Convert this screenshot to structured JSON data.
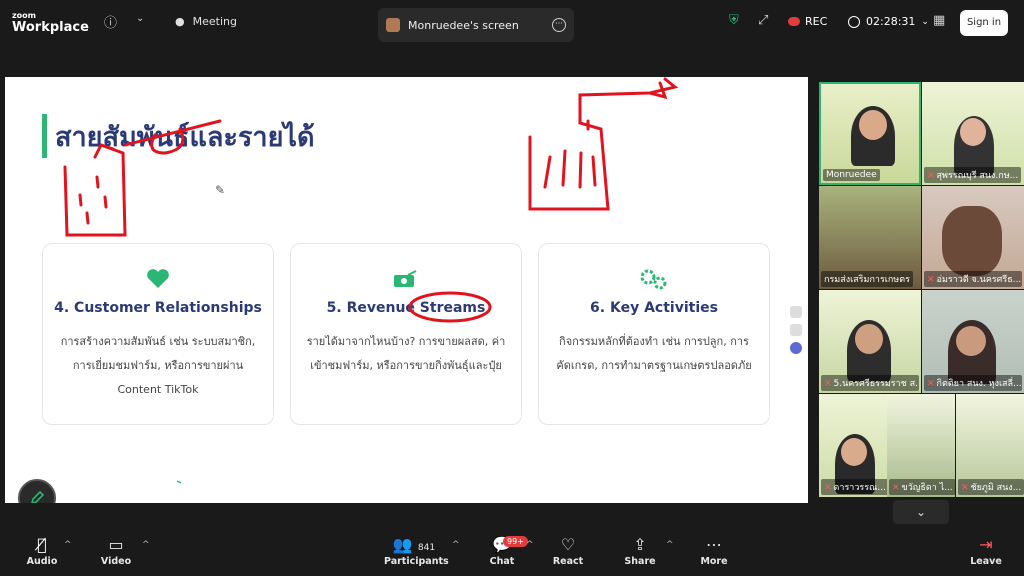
{
  "app": {
    "logo_small": "zoom",
    "logo_big": "Workplace"
  },
  "topbar": {
    "meeting_label": "Meeting",
    "screen_tab_label": "Monruedee's screen",
    "rec_label": "REC",
    "timer": "02:28:31",
    "signin_label": "Sign in"
  },
  "slide": {
    "title": "สายสัมพันธ์และรายได้",
    "cards": [
      {
        "heading": "4. Customer Relationships",
        "body": "การสร้างความสัมพันธ์ เช่น ระบบสมาชิก, การเยี่ยมชมฟาร์ม, หรือการขายผ่าน Content TikTok",
        "icon": "heart-icon"
      },
      {
        "heading": "5. Revenue Streams",
        "body": "รายได้มาจากไหนบ้าง? การขายผลสด, ค่าเข้าชมฟาร์ม, หรือการขายกิ่งพันธุ์และปุ๋ย",
        "icon": "money-icon"
      },
      {
        "heading": "6. Key Activities",
        "body": "กิจกรรมหลักที่ต้องทำ เช่น การปลูก, การคัดเกรด, การทำมาตรฐานเกษตรปลอดภัย",
        "icon": "gears-icon"
      }
    ],
    "colors": {
      "accent": "#2bb673",
      "title": "#2b3a76",
      "annotation": "#e0141e"
    }
  },
  "gallery": [
    {
      "name": "Monruedee",
      "muted": false,
      "active": true
    },
    {
      "name": "สุพรรณบุรี สนง.กษ...",
      "muted": true
    },
    {
      "name": "กรมส่งเสริมการเกษตร",
      "muted": false
    },
    {
      "name": "อ่มราวดี จ.นครศรีธ...",
      "muted": true
    },
    {
      "name": "5.นครศรีธรรมราช ส...",
      "muted": true
    },
    {
      "name": "กิตติยา สนง. หุงเสลี่...",
      "muted": true
    },
    {
      "name": "ดาราวรรณ...",
      "muted": true
    },
    {
      "name": "ขวัญธิดา ไ...",
      "muted": true
    },
    {
      "name": "ชัยภูมิ สนง...",
      "muted": true
    }
  ],
  "bottombar": {
    "audio": "Audio",
    "video": "Video",
    "participants": "Participants",
    "participants_count": "841",
    "chat": "Chat",
    "chat_badge": "99+",
    "react": "React",
    "share": "Share",
    "more": "More",
    "leave": "Leave"
  }
}
